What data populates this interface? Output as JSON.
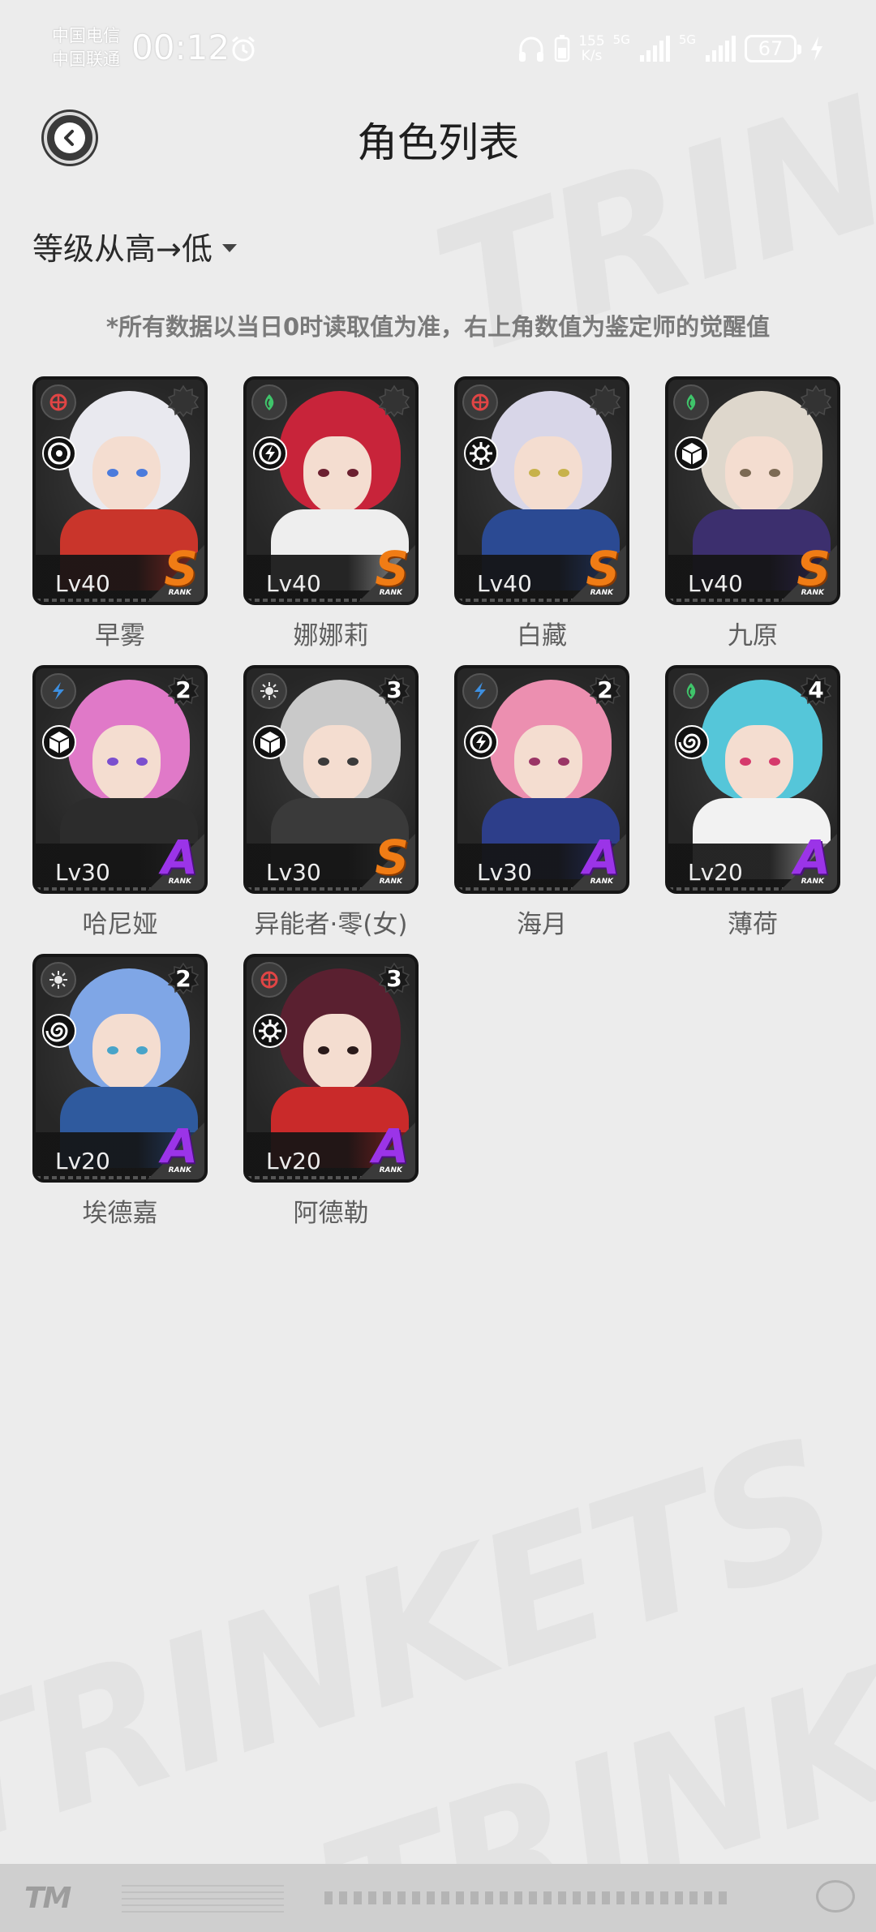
{
  "status_bar": {
    "carrier_1": "中国电信",
    "carrier_2": "中国联通",
    "time": "00:12",
    "net_speed_value": "155",
    "net_speed_unit": "K/s",
    "signal_1": "5G",
    "signal_2": "5G",
    "battery": "67"
  },
  "header": {
    "title": "角色列表"
  },
  "sort": {
    "label": "等级从高→低"
  },
  "notice": "*所有数据以当日0时读取值为准，右上角数值为鉴定师的觉醒值",
  "rank_word": "RANK",
  "characters": [
    {
      "name": "早雾",
      "level": "Lv40",
      "rank": "S",
      "awaken": "",
      "element": "fire",
      "class": "vortex",
      "hair": "#e9e9ef",
      "eye": "#4b7bdc",
      "body": "#c9352b"
    },
    {
      "name": "娜娜莉",
      "level": "Lv40",
      "rank": "S",
      "awaken": "",
      "element": "wind",
      "class": "lightning",
      "hair": "#c8243a",
      "eye": "#6b2030",
      "body": "#eeeeee"
    },
    {
      "name": "白藏",
      "level": "Lv40",
      "rank": "S",
      "awaken": "",
      "element": "fire",
      "class": "gear",
      "hair": "#d8d6e8",
      "eye": "#c7b24b",
      "body": "#2b4a93"
    },
    {
      "name": "九原",
      "level": "Lv40",
      "rank": "S",
      "awaken": "",
      "element": "wind",
      "class": "cube",
      "hair": "#ded7cc",
      "eye": "#7c6a54",
      "body": "#3c2f6e"
    },
    {
      "name": "哈尼娅",
      "level": "Lv30",
      "rank": "A",
      "awaken": "2",
      "element": "water",
      "class": "cube",
      "hair": "#e079c8",
      "eye": "#7b4fcf",
      "body": "#2c2c2c"
    },
    {
      "name": "异能者·零(女)",
      "level": "Lv30",
      "rank": "S",
      "awaken": "3",
      "element": "light",
      "class": "cube",
      "hair": "#c9c9c9",
      "eye": "#3b3b3b",
      "body": "#3a3a3a"
    },
    {
      "name": "海月",
      "level": "Lv30",
      "rank": "A",
      "awaken": "2",
      "element": "water",
      "class": "lightning",
      "hair": "#ec8fb0",
      "eye": "#9a3566",
      "body": "#2d3e8a"
    },
    {
      "name": "薄荷",
      "level": "Lv20",
      "rank": "A",
      "awaken": "4",
      "element": "wind",
      "class": "spiral",
      "hair": "#55c6d9",
      "eye": "#d53a6c",
      "body": "#f2f2f2"
    },
    {
      "name": "埃德嘉",
      "level": "Lv20",
      "rank": "A",
      "awaken": "2",
      "element": "light",
      "class": "spiral",
      "hair": "#7fa6e6",
      "eye": "#48a4c9",
      "body": "#2f5a9e"
    },
    {
      "name": "阿德勒",
      "level": "Lv20",
      "rank": "A",
      "awaken": "3",
      "element": "fire",
      "class": "gear",
      "hair": "#5a2030",
      "eye": "#2a1a1a",
      "body": "#c92a2a"
    }
  ],
  "colors": {
    "rank_S": "#f07c15",
    "rank_A": "#9b34e8",
    "element_fire": "#e04545",
    "element_wind": "#3fc46a",
    "element_water": "#3d8fe0",
    "element_light": "#e8e8e8"
  },
  "icons": {
    "back": "chevron-left-icon",
    "sort": "caret-down-icon",
    "awaken": "gear-badge-icon"
  }
}
